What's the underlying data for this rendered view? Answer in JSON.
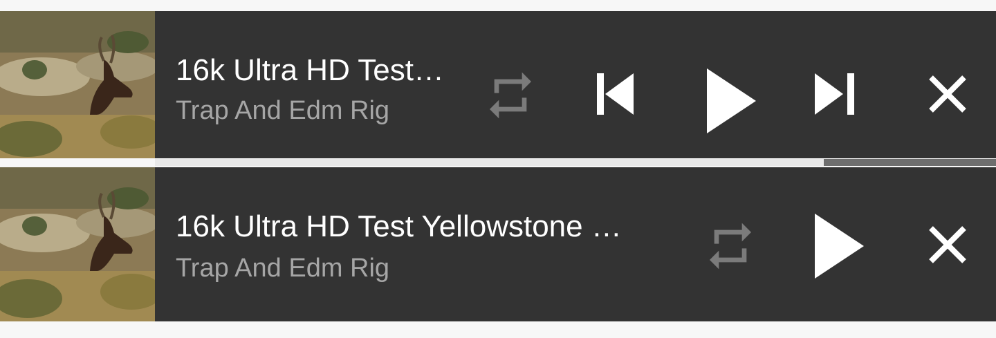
{
  "players": [
    {
      "title": "16k Ultra HD Test…",
      "artist": "Trap And Edm Rig",
      "progress_fraction": 0.795,
      "controls": [
        "repeat-icon",
        "skip-previous-icon",
        "play-icon",
        "skip-next-icon",
        "close-icon"
      ]
    },
    {
      "title": "16k Ultra HD Test Yellowstone …",
      "artist": "Trap And Edm Rig",
      "controls": [
        "repeat-icon",
        "play-icon",
        "close-icon"
      ]
    }
  ],
  "colors": {
    "panel": "#333333",
    "title": "#ffffff",
    "subtitle": "#a6a6a6",
    "repeat_inactive": "#7b7b7b",
    "progress_fill": "#e9e9e9",
    "progress_track": "#6e6e6e"
  }
}
